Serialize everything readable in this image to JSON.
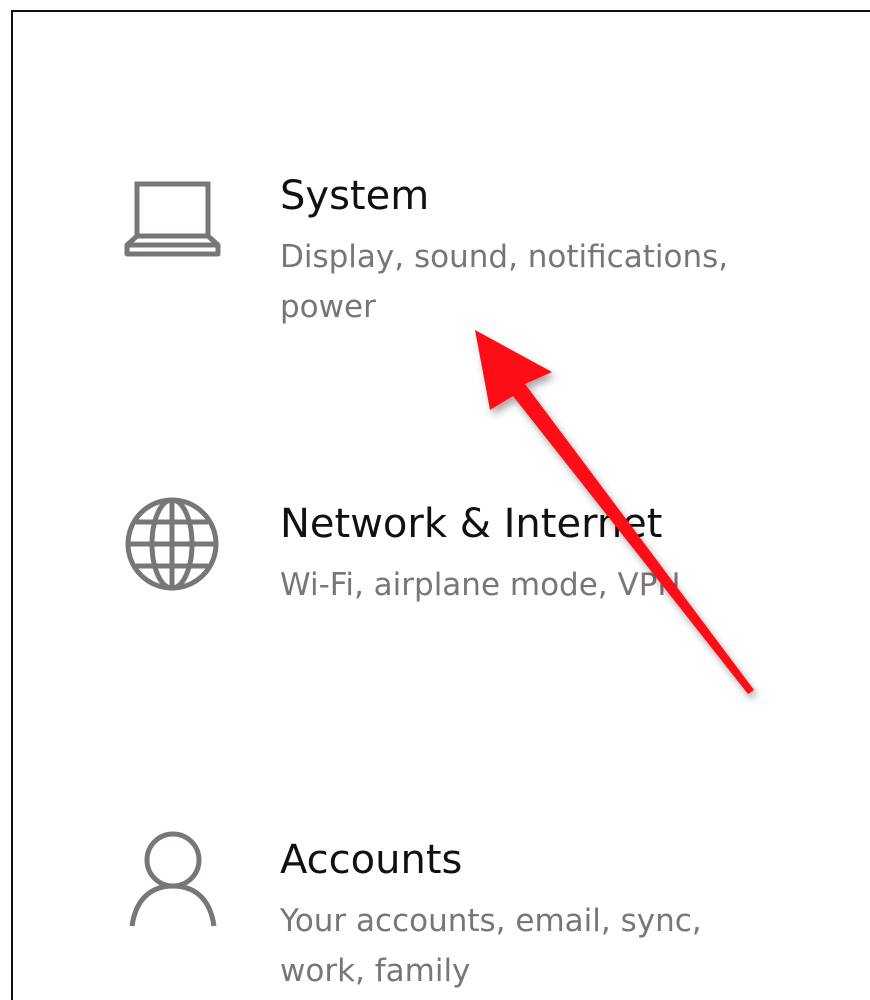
{
  "settings": {
    "tiles": [
      {
        "title": "System",
        "description": "Display, sound, notifications, power",
        "icon": "laptop-icon"
      },
      {
        "title": "Network & Internet",
        "description": "Wi-Fi, airplane mode, VPN",
        "icon": "globe-icon"
      },
      {
        "title": "Accounts",
        "description": "Your accounts, email, sync, work, family",
        "icon": "person-icon"
      }
    ],
    "icon_color": "#7a7676"
  },
  "annotation": {
    "arrow_color": "#ff0a16",
    "arrow_icon": "red-arrow-icon"
  }
}
